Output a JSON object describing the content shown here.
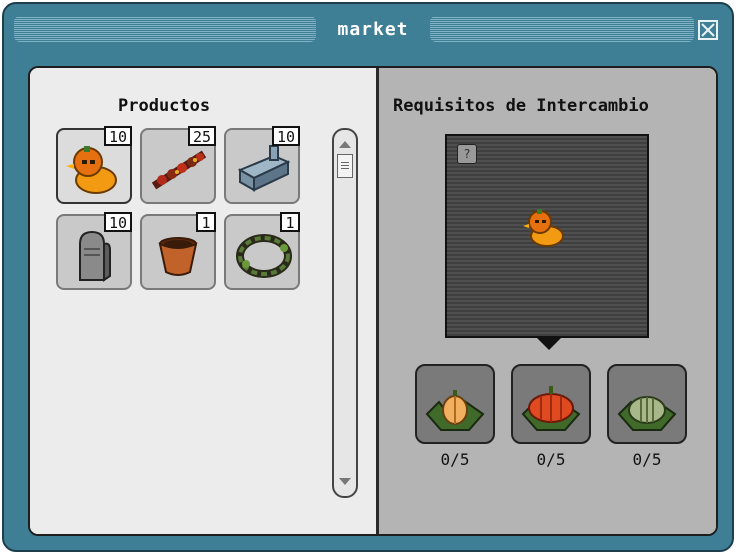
{
  "window": {
    "title": "market"
  },
  "products": {
    "title": "Productos",
    "items": [
      {
        "name": "pumpkin-duck",
        "count": "10"
      },
      {
        "name": "autumn-garland",
        "count": "25"
      },
      {
        "name": "metal-machine",
        "count": "10"
      },
      {
        "name": "gravestone",
        "count": "10"
      },
      {
        "name": "flower-pot",
        "count": "1"
      },
      {
        "name": "vine-wreath",
        "count": "1"
      }
    ]
  },
  "requirements": {
    "title": "Requisitos de Intercambio",
    "help_label": "?",
    "items": [
      {
        "name": "orange-pumpkin",
        "progress": "0/5"
      },
      {
        "name": "red-pumpkin",
        "progress": "0/5"
      },
      {
        "name": "green-pumpkin",
        "progress": "0/5"
      }
    ]
  },
  "colors": {
    "window_bg": "#3e7f95",
    "left_panel_bg": "#ececec",
    "right_panel_bg": "#b4b4b4"
  }
}
